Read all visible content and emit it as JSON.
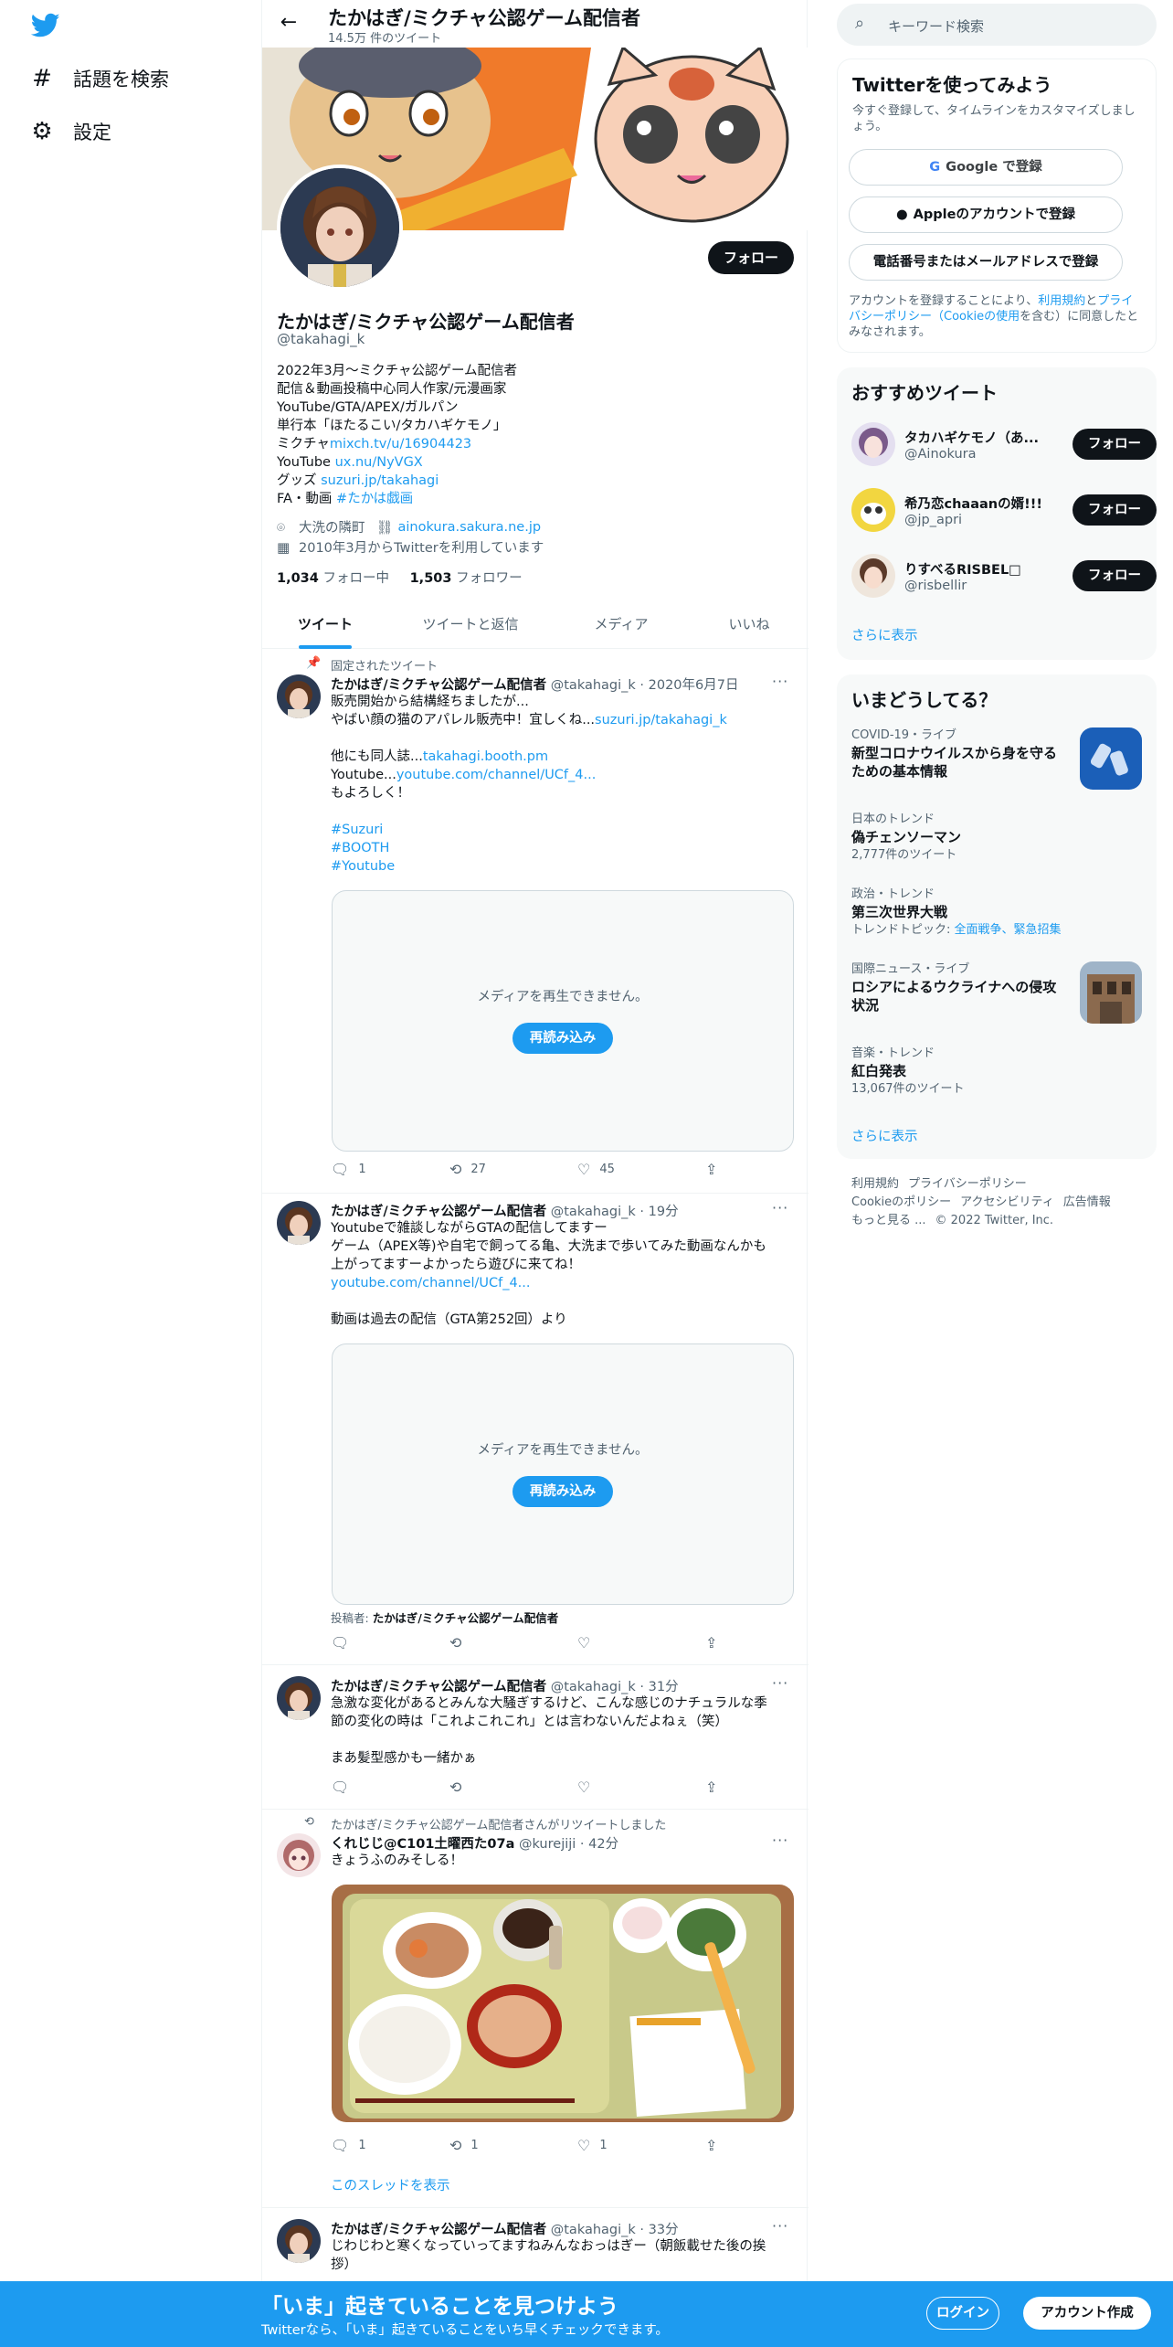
{
  "nav": {
    "explore": "話題を検索",
    "settings": "設定"
  },
  "header": {
    "name": "たかはぎ/ミクチャ公認ゲーム配信者",
    "tweet_count": "14.5万 件のツイート"
  },
  "profile": {
    "follow": "フォロー",
    "name": "たかはぎ/ミクチャ公認ゲーム配信者",
    "handle": "@takahagi_k",
    "bio": {
      "line1": "2022年3月～ミクチャ公認ゲーム配信者",
      "line2": "配信＆動画投稿中心同人作家/元漫画家",
      "line3": "YouTube/GTA/APEX/ガルパン",
      "line4": "単行本「ほたるこい/タカハギケモノ」",
      "line5_text": "ミクチャ",
      "line5_link": "mixch.tv/u/16904423",
      "line6_text": "YouTube ",
      "line6_link": "ux.nu/NyVGX",
      "line7_text": "グッズ ",
      "line7_link": "suzuri.jp/takahagi",
      "line8_text": "FA・動画 ",
      "line8_link": "#たかは戯画"
    },
    "location": "大洗の隣町",
    "website": "ainokura.sakura.ne.jp",
    "joined": "2010年3月からTwitterを利用しています",
    "following_count": "1,034",
    "following_label": " フォロー中",
    "followers_count": "1,503",
    "followers_label": " フォロワー"
  },
  "tabs": [
    "ツイート",
    "ツイートと返信",
    "メディア",
    "いいね"
  ],
  "tweets": {
    "t1": {
      "pinned": "固定されたツイート",
      "name": "たかはぎ/ミクチャ公認ゲーム配信者",
      "meta": " @takahagi_k · 2020年6月7日",
      "l1": "販売開始から結構経ちましたが...",
      "l2_text": "やばい顔の猫のアパレル販売中！宜しくね...",
      "l2_link": "suzuri.jp/takahagi_k",
      "l3_text": "他にも同人誌...",
      "l3_link": "takahagi.booth.pm",
      "l4_text": "Youtube...",
      "l4_link": "youtube.com/channel/UCf_4...",
      "l5": "もよろしく！",
      "tag1": "#Suzuri",
      "tag2": "#BOOTH",
      "tag3": "#Youtube",
      "media_msg": "メディアを再生できません。",
      "reload": "再読み込み",
      "replies": "1",
      "retweets": "27",
      "likes": "45"
    },
    "t2": {
      "name": "たかはぎ/ミクチャ公認ゲーム配信者",
      "meta": " @takahagi_k · 19分",
      "l1": "Youtubeで雑談しながらGTAの配信してますー",
      "l2": "ゲーム（APEX等)や自宅で飼ってる亀、大洗まで歩いてみた動画なんかも",
      "l3": "上がってますーよかったら遊びに来てね！",
      "l4_link": "youtube.com/channel/UCf_4...",
      "l5": "動画は過去の配信（GTA第252回）より",
      "media_msg": "メディアを再生できません。",
      "reload": "再読み込み",
      "poster_label": "投稿者: ",
      "poster": "たかはぎ/ミクチャ公認ゲーム配信者"
    },
    "t3": {
      "name": "たかはぎ/ミクチャ公認ゲーム配信者",
      "meta": " @takahagi_k · 31分",
      "l1": "急激な変化があるとみんな大騒ぎするけど、こんな感じのナチュラルな季",
      "l2": "節の変化の時は「これよこれこれ」とは言わないんだよねぇ（笑）",
      "l3": "まあ髪型感かも一緒かぁ"
    },
    "t4": {
      "retweeted_by": "たかはぎ/ミクチャ公認ゲーム配信者さんがリツイートしました",
      "name": "くれじじ@C101土曜西た07a",
      "meta": " @kurejiji · 42分",
      "l1": "きょうふのみそしる！",
      "replies": "1",
      "retweets": "1",
      "likes": "1",
      "thread": "このスレッドを表示"
    },
    "t5": {
      "name": "たかはぎ/ミクチャ公認ゲーム配信者",
      "meta": " @takahagi_k · 33分",
      "l1": "じわじわと寒くなっていってますねみんなおっはぎー（朝飯載せた後の挨",
      "l2": "拶）"
    }
  },
  "sidebar": {
    "search_placeholder": "キーワード検索",
    "signup": {
      "title": "Twitterを使ってみよう",
      "subtitle": "今すぐ登録して、タイムラインをカスタマイズしましょう。",
      "google": "Google で登録",
      "apple": "Appleのアカウントで登録",
      "phone": "電話番号またはメールアドレスで登録",
      "terms_1": "アカウントを登録することにより、",
      "terms_link1": "利用規約",
      "terms_2": "と",
      "terms_link2": "プライバシーポリシー（Cookieの使用",
      "terms_3": "を含む）に同意したとみなされます。"
    },
    "reco": {
      "title": "おすすめツイート",
      "users": [
        {
          "name": "タカハギケモノ（あ...",
          "handle": "@Ainokura"
        },
        {
          "name": "希乃恋chaaanの婿!!!",
          "handle": "@jp_apri"
        },
        {
          "name": "りすべるRISBEL□",
          "handle": "@risbellir"
        }
      ],
      "follow": "フォロー",
      "more": "さらに表示"
    },
    "trends": {
      "title": "いまどうしてる？",
      "items": [
        {
          "cat": "COVID-19・ライブ",
          "title": "新型コロナウイルスから身を守るための基本情報",
          "t1": "新型コロナウイルスから身を守る",
          "t2": "ための基本情報"
        },
        {
          "cat": "日本のトレンド",
          "title": "偽チェンソーマン",
          "meta": "2,777件のツイート"
        },
        {
          "cat": "政治・トレンド",
          "title": "第三次世界大戦",
          "meta_label": "トレンドトピック: ",
          "meta_links": "全面戦争、緊急招集"
        },
        {
          "cat": "国際ニュース・ライブ",
          "t1": "ロシアによるウクライナへの侵攻",
          "t2": "状況"
        },
        {
          "cat": "音楽・トレンド",
          "title": "紅白発表",
          "meta": "13,067件のツイート"
        }
      ],
      "more": "さらに表示"
    },
    "footer": {
      "terms": "利用規約",
      "privacy": "プライバシーポリシー",
      "cookie": "Cookieのポリシー",
      "access": "アクセシビリティ",
      "ads": "広告情報",
      "more": "もっと見る ...",
      "copy": "© 2022 Twitter, Inc."
    }
  },
  "bottom_bar": {
    "title": "「いま」起きていることを見つけよう",
    "subtitle": "Twitterなら、「いま」起きていることをいち早くチェックできます。",
    "login": "ログイン",
    "signup": "アカウント作成"
  },
  "colors": {
    "accent": "#1d9bf0",
    "text": "#0f1419",
    "muted": "#536471"
  }
}
